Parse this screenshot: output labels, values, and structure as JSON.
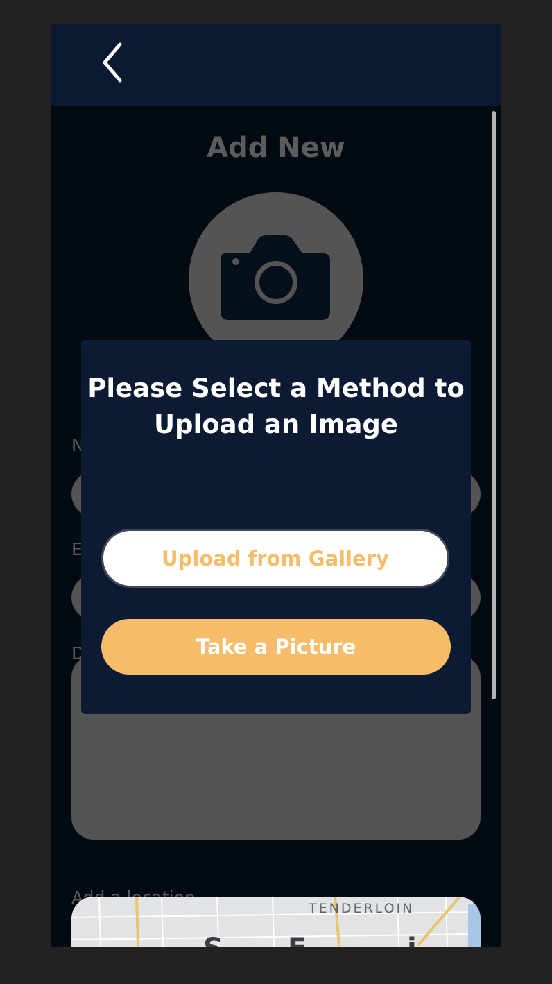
{
  "header": {
    "back_icon": "chevron-left-icon"
  },
  "page": {
    "title": "Add New",
    "photo_icon": "camera-icon"
  },
  "form": {
    "name_label": "N",
    "email_label": "E",
    "description_label": "D",
    "location_label": "Add a location"
  },
  "map": {
    "neighborhood": "TENDERLOIN",
    "big_letters": [
      "S",
      "F",
      "i"
    ]
  },
  "modal": {
    "title": "Please Select a Method to Upload an Image",
    "gallery_button": "Upload from Gallery",
    "picture_button": "Take a Picture"
  },
  "colors": {
    "header_bg": "#0b1a30",
    "modal_bg": "#0c1b33",
    "accent": "#f5bd69"
  }
}
